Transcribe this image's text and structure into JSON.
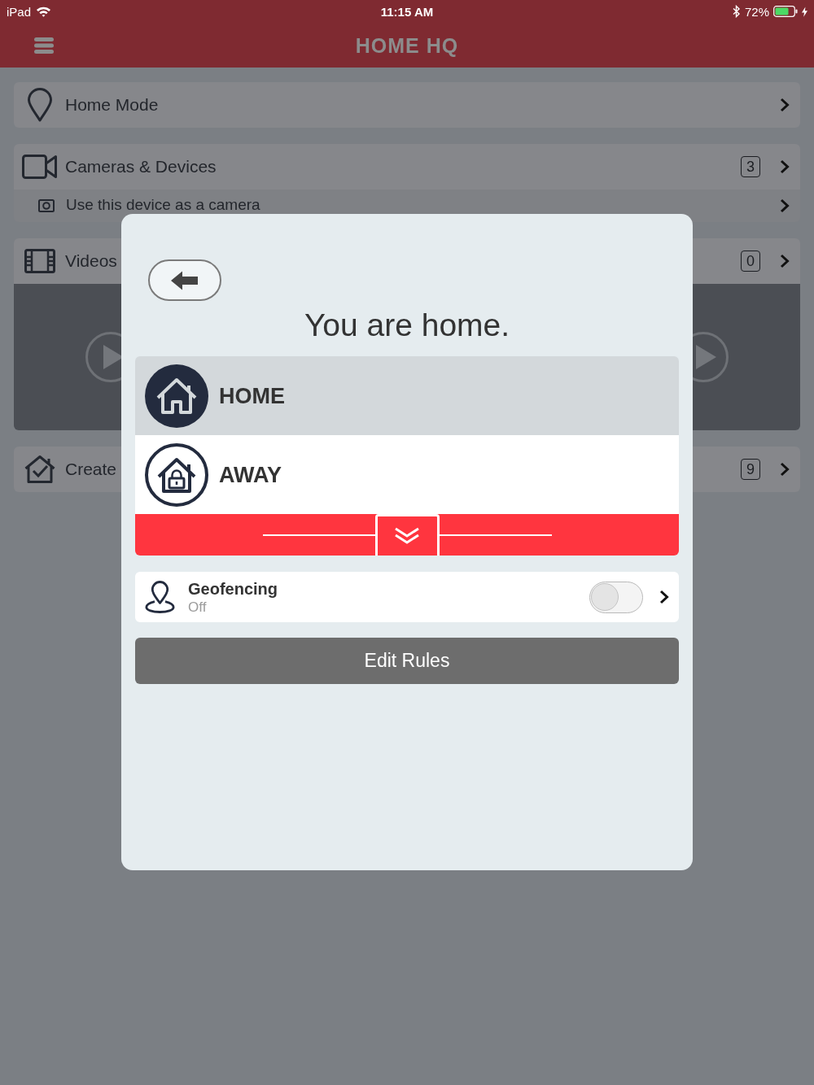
{
  "status_bar": {
    "carrier": "iPad",
    "time": "11:15 AM",
    "battery": "72%"
  },
  "nav_bar": {
    "title": "HOME HQ"
  },
  "menu": [
    {
      "kind": "home_mode",
      "label": "Home Mode"
    },
    {
      "kind": "cameras",
      "label": "Cameras & Devices",
      "badge": "3",
      "sub_items": [
        {
          "kind": "camera",
          "label": "Use this device as a camera"
        }
      ]
    },
    {
      "kind": "videos",
      "label": "Videos",
      "badge": "0"
    },
    {
      "kind": "create",
      "label": "Create",
      "badge": "9"
    }
  ],
  "modal": {
    "title": "You are home.",
    "modes": [
      {
        "kind": "home",
        "label": "HOME",
        "selected": true
      },
      {
        "kind": "away",
        "label": "AWAY",
        "selected": false
      }
    ],
    "geofencing": {
      "title": "Geofencing",
      "status": "Off",
      "on": false
    },
    "button": "Edit Rules"
  }
}
